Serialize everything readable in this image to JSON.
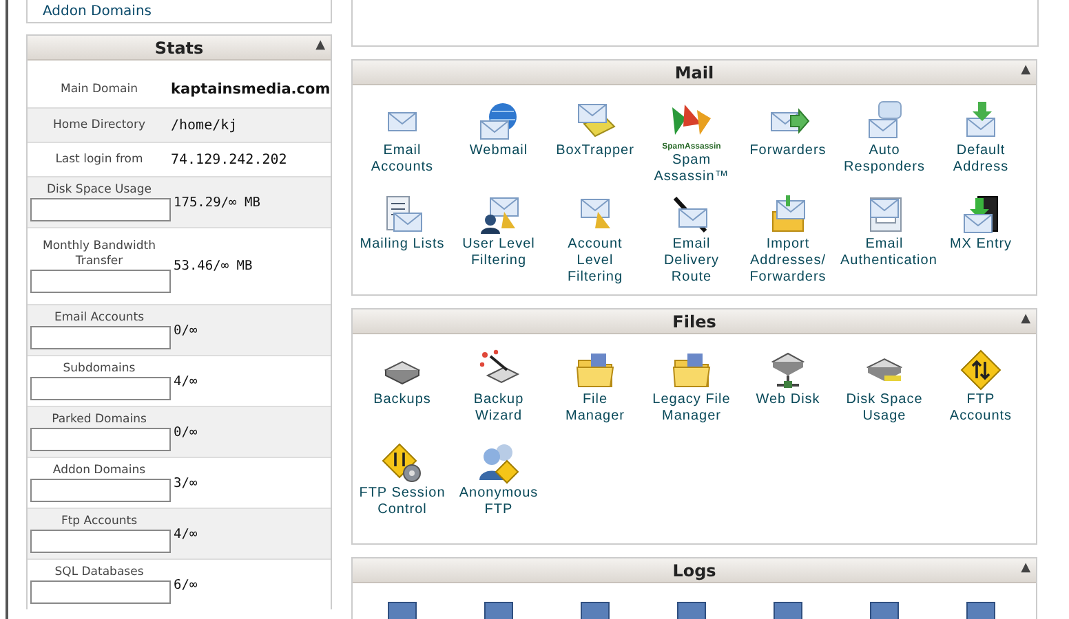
{
  "top_box": {
    "link": "Addon Domains"
  },
  "stats": {
    "title": "Stats",
    "collapse": "▲",
    "info": [
      {
        "label": "Main Domain",
        "value": "kaptainsmedia.com",
        "bold": true
      },
      {
        "label": "Home Directory",
        "value": "/home/kj",
        "bold": false
      },
      {
        "label": "Last login from",
        "value": "74.129.242.202",
        "bold": false
      }
    ],
    "usage": [
      {
        "label": "Disk Space Usage",
        "value": "175.29/∞ MB"
      },
      {
        "label": "Monthly Bandwidth Transfer",
        "value": "53.46/∞ MB"
      },
      {
        "label": "Email Accounts",
        "value": "0/∞"
      },
      {
        "label": "Subdomains",
        "value": "4/∞"
      },
      {
        "label": "Parked Domains",
        "value": "0/∞"
      },
      {
        "label": "Addon Domains",
        "value": "3/∞"
      },
      {
        "label": "Ftp Accounts",
        "value": "4/∞"
      },
      {
        "label": "SQL Databases",
        "value": "6/∞"
      }
    ]
  },
  "panels": [
    {
      "title": "Mail",
      "collapse": "▲",
      "items": [
        {
          "label": "Email Accounts"
        },
        {
          "label": "Webmail"
        },
        {
          "label": "BoxTrapper"
        },
        {
          "label": "Spam Assassin™",
          "logo_text": "SpamAssassin"
        },
        {
          "label": "Forwarders"
        },
        {
          "label": "Auto Responders"
        },
        {
          "label": "Default Address"
        },
        {
          "label": "Mailing Lists"
        },
        {
          "label": "User Level Filtering"
        },
        {
          "label": "Account Level Filtering"
        },
        {
          "label": "Email Delivery Route"
        },
        {
          "label": "Import Addresses/ Forwarders"
        },
        {
          "label": "Email Authentication"
        },
        {
          "label": "MX Entry"
        }
      ]
    },
    {
      "title": "Files",
      "collapse": "▲",
      "items": [
        {
          "label": "Backups"
        },
        {
          "label": "Backup Wizard"
        },
        {
          "label": "File Manager"
        },
        {
          "label": "Legacy File Manager"
        },
        {
          "label": "Web Disk"
        },
        {
          "label": "Disk Space Usage"
        },
        {
          "label": "FTP Accounts"
        },
        {
          "label": "FTP Session Control"
        },
        {
          "label": "Anonymous FTP"
        }
      ]
    },
    {
      "title": "Logs",
      "collapse": "▲"
    }
  ]
}
